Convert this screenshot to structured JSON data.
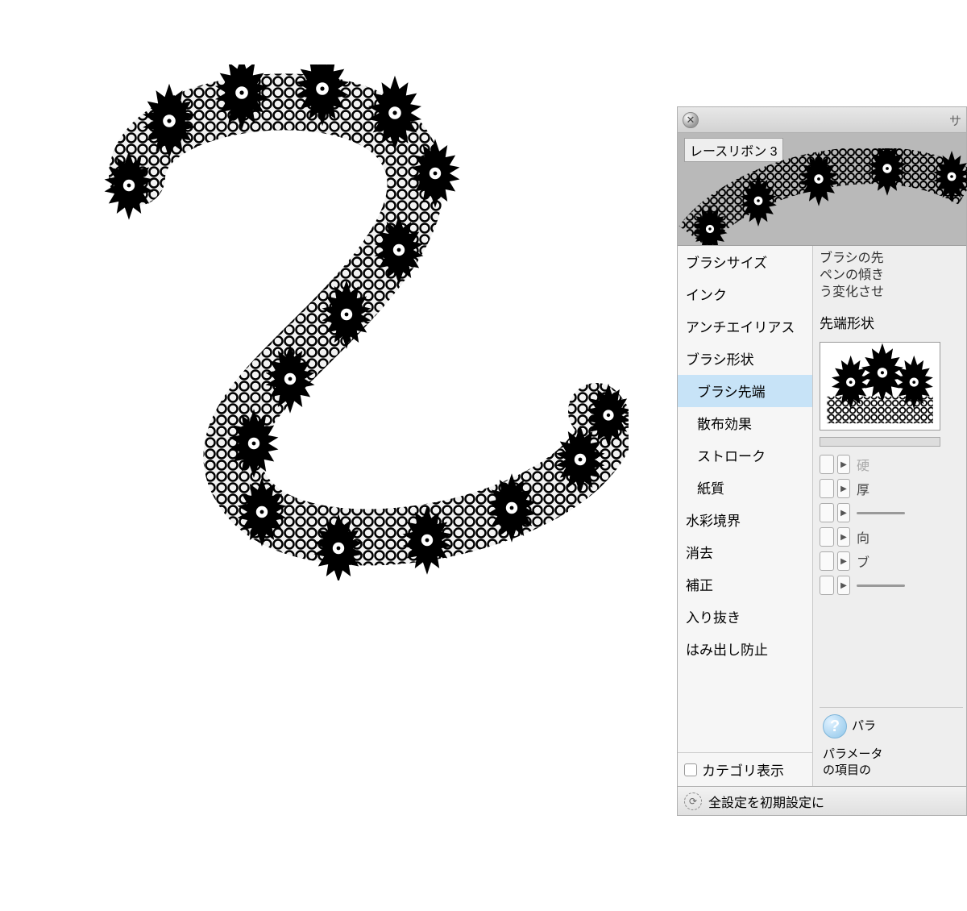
{
  "panel": {
    "titlebar_hint": "サ",
    "brush_name": "レースリボン 3"
  },
  "categories": {
    "items": [
      {
        "label": "ブラシサイズ",
        "sub": false,
        "selected": false
      },
      {
        "label": "インク",
        "sub": false,
        "selected": false
      },
      {
        "label": "アンチエイリアス",
        "sub": false,
        "selected": false
      },
      {
        "label": "ブラシ形状",
        "sub": false,
        "selected": false
      },
      {
        "label": "ブラシ先端",
        "sub": true,
        "selected": true
      },
      {
        "label": "散布効果",
        "sub": true,
        "selected": false
      },
      {
        "label": "ストローク",
        "sub": true,
        "selected": false
      },
      {
        "label": "紙質",
        "sub": true,
        "selected": false
      },
      {
        "label": "水彩境界",
        "sub": false,
        "selected": false
      },
      {
        "label": "消去",
        "sub": false,
        "selected": false
      },
      {
        "label": "補正",
        "sub": false,
        "selected": false
      },
      {
        "label": "入り抜き",
        "sub": false,
        "selected": false
      },
      {
        "label": "はみ出し防止",
        "sub": false,
        "selected": false
      }
    ],
    "toggle_label": "カテゴリ表示"
  },
  "detail": {
    "description": "ブラシの先\nペンの傾き\nう変化させ",
    "shape_label": "先端形状",
    "sliders": [
      {
        "label": "硬",
        "disabled": true
      },
      {
        "label": "厚",
        "disabled": false
      },
      {
        "label": "",
        "disabled": false
      },
      {
        "label": "向",
        "disabled": false
      },
      {
        "label": "ブ",
        "disabled": false
      },
      {
        "label": "",
        "disabled": false
      }
    ]
  },
  "help": {
    "title": "パラ",
    "body1": "パラメータ",
    "body2": "の項目の"
  },
  "footer": {
    "reset_label": "全設定を初期設定に"
  }
}
